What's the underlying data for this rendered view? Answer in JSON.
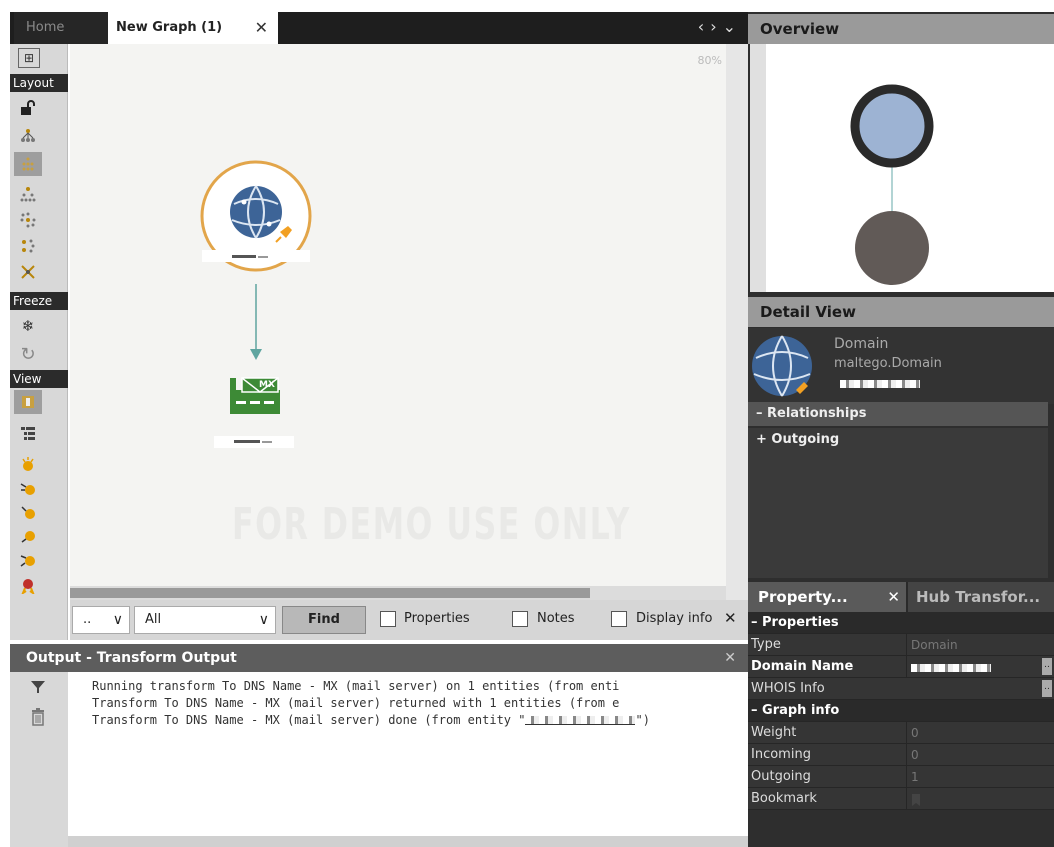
{
  "tabs": {
    "home": "Home",
    "graph": "New Graph (1)",
    "close": "✕",
    "nav": "‹›⌄"
  },
  "toolbar": {
    "layout_label": "Layout",
    "freeze_label": "Freeze",
    "view_label": "View"
  },
  "canvas": {
    "zoom": "80%",
    "watermark": "FOR DEMO USE ONLY",
    "nodes": [
      {
        "type": "maltego.Domain",
        "icon": "globe-icon",
        "label_redacted": true
      },
      {
        "type": "maltego.MXRecord",
        "icon": "mx-mail-icon",
        "badge": "MX",
        "label_redacted": true
      }
    ]
  },
  "findbar": {
    "select1": "..",
    "select2": "All",
    "find_button": "Find",
    "properties_label": "Properties",
    "notes_label": "Notes",
    "display_label": "Display info",
    "close": "✕"
  },
  "output": {
    "title": "Output - Transform Output",
    "close": "✕",
    "lines": [
      "Running transform To DNS Name - MX (mail server) on 1 entities (from enti",
      "Transform To DNS Name - MX (mail server) returned with 1 entities (from e",
      "Transform To DNS Name - MX (mail server) done (from entity \""
    ],
    "line3_tail": "\")"
  },
  "overview": {
    "title": "Overview",
    "colors": {
      "domain_node": "#9db3d3",
      "domain_ring": "#2a2a2a",
      "mx_node": "#615a57"
    }
  },
  "detail": {
    "title": "Detail View",
    "entity_type": "Domain",
    "entity_type_id": "maltego.Domain",
    "relationships": "– Relationships",
    "outgoing": "+ Outgoing"
  },
  "properties": {
    "tab_properties": "Property...",
    "tab_close": "✕",
    "tab_hub": "Hub Transfor...",
    "section_properties": "– Properties",
    "section_graph": "– Graph info",
    "rows": [
      {
        "key": "Type",
        "value": "Domain"
      },
      {
        "key": "Domain Name",
        "value": ""
      },
      {
        "key": "WHOIS Info",
        "value": ""
      }
    ],
    "graph_rows": [
      {
        "key": "Weight",
        "value": "0"
      },
      {
        "key": "Incoming",
        "value": "0"
      },
      {
        "key": "Outgoing",
        "value": "1"
      },
      {
        "key": "Bookmark",
        "value": ""
      }
    ]
  }
}
